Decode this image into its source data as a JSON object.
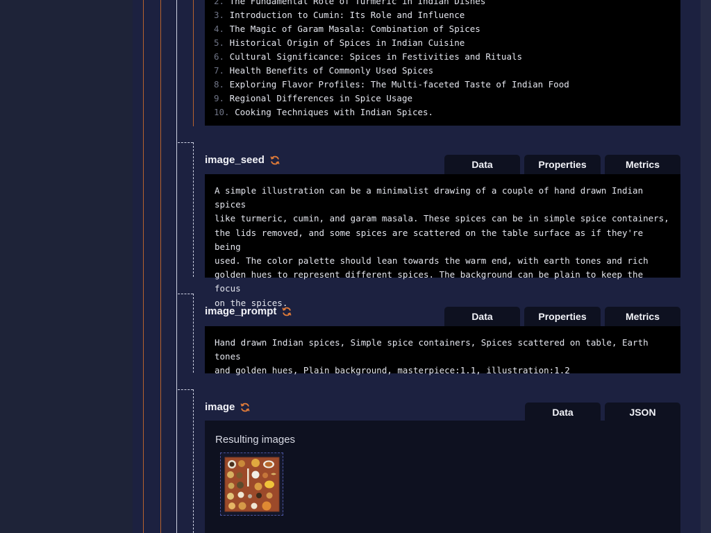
{
  "outline": {
    "items": [
      {
        "num": "2.",
        "text": "The Fundamental Role of Turmeric in Indian Dishes"
      },
      {
        "num": "3.",
        "text": "Introduction to Cumin: Its Role and Influence"
      },
      {
        "num": "4.",
        "text": "The Magic of Garam Masala: Combination of Spices"
      },
      {
        "num": "5.",
        "text": "Historical Origin of Spices in Indian Cuisine"
      },
      {
        "num": "6.",
        "text": "Cultural Significance: Spices in Festivities and Rituals"
      },
      {
        "num": "7.",
        "text": "Health Benefits of Commonly Used Spices"
      },
      {
        "num": "8.",
        "text": "Exploring Flavor Profiles: The Multi-faceted Taste of Indian Food"
      },
      {
        "num": "9.",
        "text": "Regional Differences in Spice Usage"
      },
      {
        "num": "10.",
        "text": "Cooking Techniques with Indian Spices."
      }
    ]
  },
  "image_seed": {
    "label": "image_seed",
    "tabs": [
      "Data",
      "Properties",
      "Metrics"
    ],
    "text": "A simple illustration can be a minimalist drawing of a couple of hand drawn Indian spices\nlike turmeric, cumin, and garam masala. These spices can be in simple spice containers,\nthe lids removed, and some spices are scattered on the table surface as if they're being\nused. The color palette should lean towards the warm end, with earth tones and rich\ngolden hues to represent different spices. The background can be plain to keep the focus\non the spices."
  },
  "image_prompt": {
    "label": "image_prompt",
    "tabs": [
      "Data",
      "Properties",
      "Metrics"
    ],
    "text": "Hand drawn Indian spices, Simple spice containers, Spices scattered on table, Earth tones\nand golden hues, Plain background, masterpiece:1.1, illustration:1.2"
  },
  "image": {
    "label": "image",
    "tabs": [
      "Data",
      "JSON"
    ],
    "results_title": "Resulting images"
  },
  "icons": {
    "refresh": "refresh-icon"
  },
  "colors": {
    "accent_orange": "#e07b39",
    "panel_bg": "#1c2140",
    "code_bg": "#000000",
    "tab_bg": "#0e1120"
  }
}
